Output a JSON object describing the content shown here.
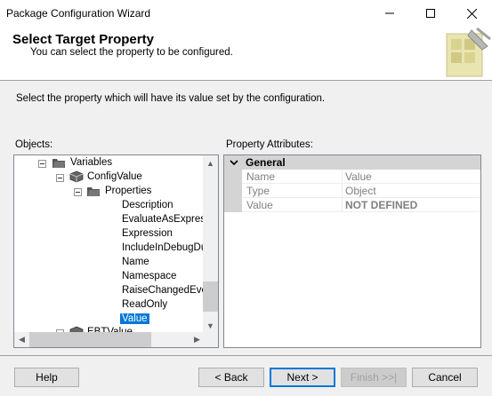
{
  "window": {
    "title": "Package Configuration Wizard"
  },
  "header": {
    "title": "Select Target Property",
    "subtitle": "You can select the property to be configured."
  },
  "instruction": "Select the property which will have its value set by the configuration.",
  "objects_label": "Objects:",
  "attributes_label": "Property Attributes:",
  "tree": {
    "variables": "Variables",
    "config_value": "ConfigValue",
    "properties": "Properties",
    "items": [
      "Description",
      "EvaluateAsExpressi",
      "Expression",
      "IncludeInDebugDur",
      "Name",
      "Namespace",
      "RaiseChangedEver",
      "ReadOnly"
    ],
    "selected": "Value",
    "next_var": "EBTValue"
  },
  "attributes": {
    "category": "General",
    "rows": [
      {
        "name": "Name",
        "value": "Value"
      },
      {
        "name": "Type",
        "value": "Object"
      },
      {
        "name": "Value",
        "value": "NOT DEFINED"
      }
    ]
  },
  "buttons": {
    "help": "Help",
    "back": "< Back",
    "next": "Next >",
    "finish": "Finish >>|",
    "cancel": "Cancel"
  }
}
